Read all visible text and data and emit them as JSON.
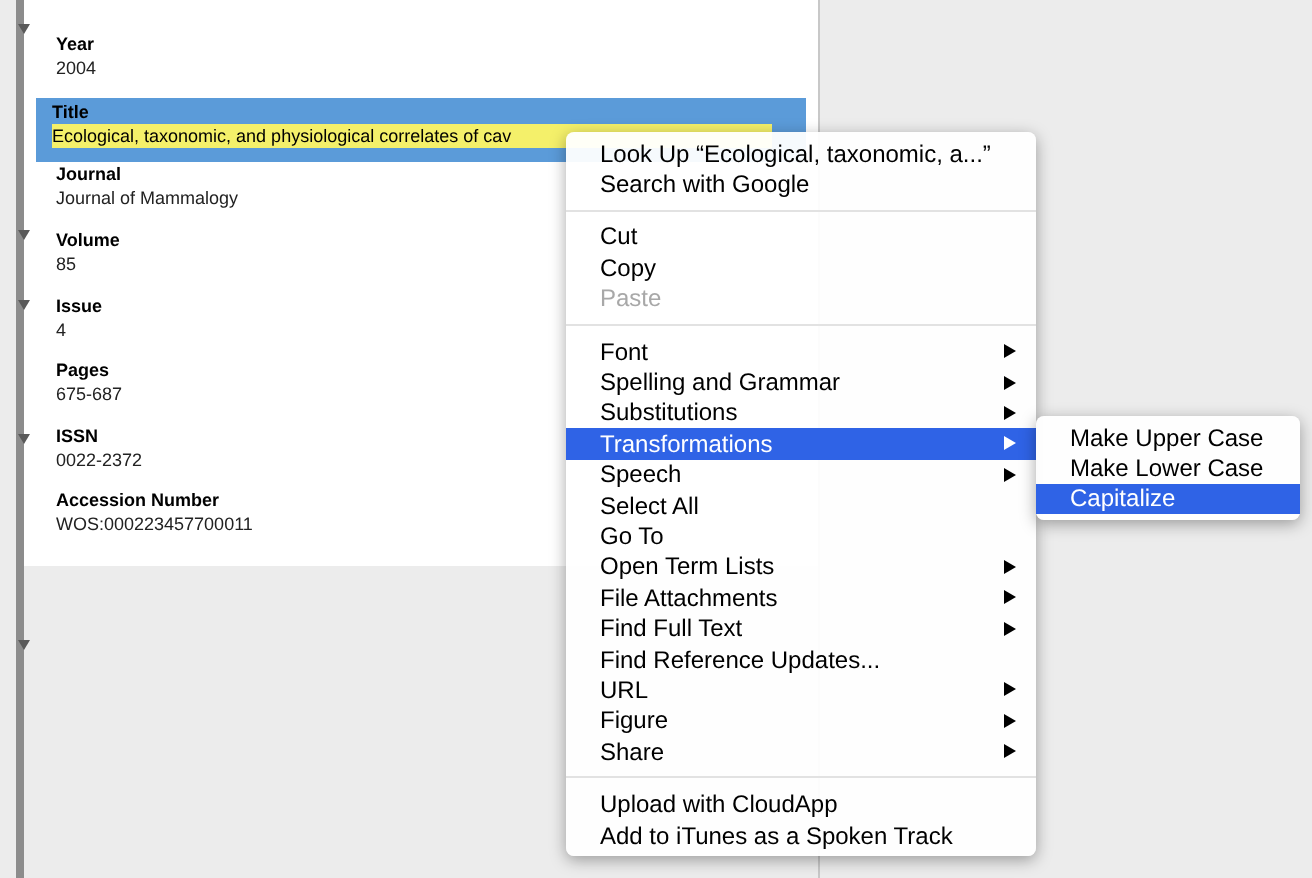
{
  "fields": [
    {
      "label": "Year",
      "value": "2004",
      "selected": false
    },
    {
      "label": "Title",
      "value": "Ecological, taxonomic, and physiological correlates of cav",
      "selected": true
    },
    {
      "label": "Journal",
      "value": "Journal of Mammalogy",
      "selected": false
    },
    {
      "label": "Volume",
      "value": "85",
      "selected": false
    },
    {
      "label": "Issue",
      "value": "4",
      "selected": false
    },
    {
      "label": "Pages",
      "value": "675-687",
      "selected": false
    },
    {
      "label": "ISSN",
      "value": "0022-2372",
      "selected": false
    },
    {
      "label": "Accession Number",
      "value": "WOS:000223457700011",
      "selected": false
    }
  ],
  "context_menu": {
    "items": [
      {
        "kind": "item",
        "label": "Look Up “Ecological, taxonomic, a...”",
        "disabled": false,
        "has_submenu": false,
        "selected": false
      },
      {
        "kind": "item",
        "label": "Search with Google",
        "disabled": false,
        "has_submenu": false,
        "selected": false
      },
      {
        "kind": "separator"
      },
      {
        "kind": "item",
        "label": "Cut",
        "disabled": false,
        "has_submenu": false,
        "selected": false
      },
      {
        "kind": "item",
        "label": "Copy",
        "disabled": false,
        "has_submenu": false,
        "selected": false
      },
      {
        "kind": "item",
        "label": "Paste",
        "disabled": true,
        "has_submenu": false,
        "selected": false
      },
      {
        "kind": "separator"
      },
      {
        "kind": "item",
        "label": "Font",
        "disabled": false,
        "has_submenu": true,
        "selected": false
      },
      {
        "kind": "item",
        "label": "Spelling and Grammar",
        "disabled": false,
        "has_submenu": true,
        "selected": false
      },
      {
        "kind": "item",
        "label": "Substitutions",
        "disabled": false,
        "has_submenu": true,
        "selected": false
      },
      {
        "kind": "item",
        "label": "Transformations",
        "disabled": false,
        "has_submenu": true,
        "selected": true
      },
      {
        "kind": "item",
        "label": "Speech",
        "disabled": false,
        "has_submenu": true,
        "selected": false
      },
      {
        "kind": "item",
        "label": "Select All",
        "disabled": false,
        "has_submenu": false,
        "selected": false
      },
      {
        "kind": "item",
        "label": "Go To",
        "disabled": false,
        "has_submenu": false,
        "selected": false
      },
      {
        "kind": "item",
        "label": "Open Term Lists",
        "disabled": false,
        "has_submenu": true,
        "selected": false
      },
      {
        "kind": "item",
        "label": "File Attachments",
        "disabled": false,
        "has_submenu": true,
        "selected": false
      },
      {
        "kind": "item",
        "label": "Find Full Text",
        "disabled": false,
        "has_submenu": true,
        "selected": false
      },
      {
        "kind": "item",
        "label": "Find Reference Updates...",
        "disabled": false,
        "has_submenu": false,
        "selected": false
      },
      {
        "kind": "item",
        "label": "URL",
        "disabled": false,
        "has_submenu": true,
        "selected": false
      },
      {
        "kind": "item",
        "label": "Figure",
        "disabled": false,
        "has_submenu": true,
        "selected": false
      },
      {
        "kind": "item",
        "label": "Share",
        "disabled": false,
        "has_submenu": true,
        "selected": false
      },
      {
        "kind": "separator"
      },
      {
        "kind": "item",
        "label": "Upload with CloudApp",
        "disabled": false,
        "has_submenu": false,
        "selected": false
      },
      {
        "kind": "item",
        "label": "Add to iTunes as a Spoken Track",
        "disabled": false,
        "has_submenu": false,
        "selected": false
      }
    ]
  },
  "submenu": {
    "items": [
      {
        "label": "Make Upper Case",
        "selected": false
      },
      {
        "label": "Make Lower Case",
        "selected": false
      },
      {
        "label": "Capitalize",
        "selected": true
      }
    ]
  }
}
